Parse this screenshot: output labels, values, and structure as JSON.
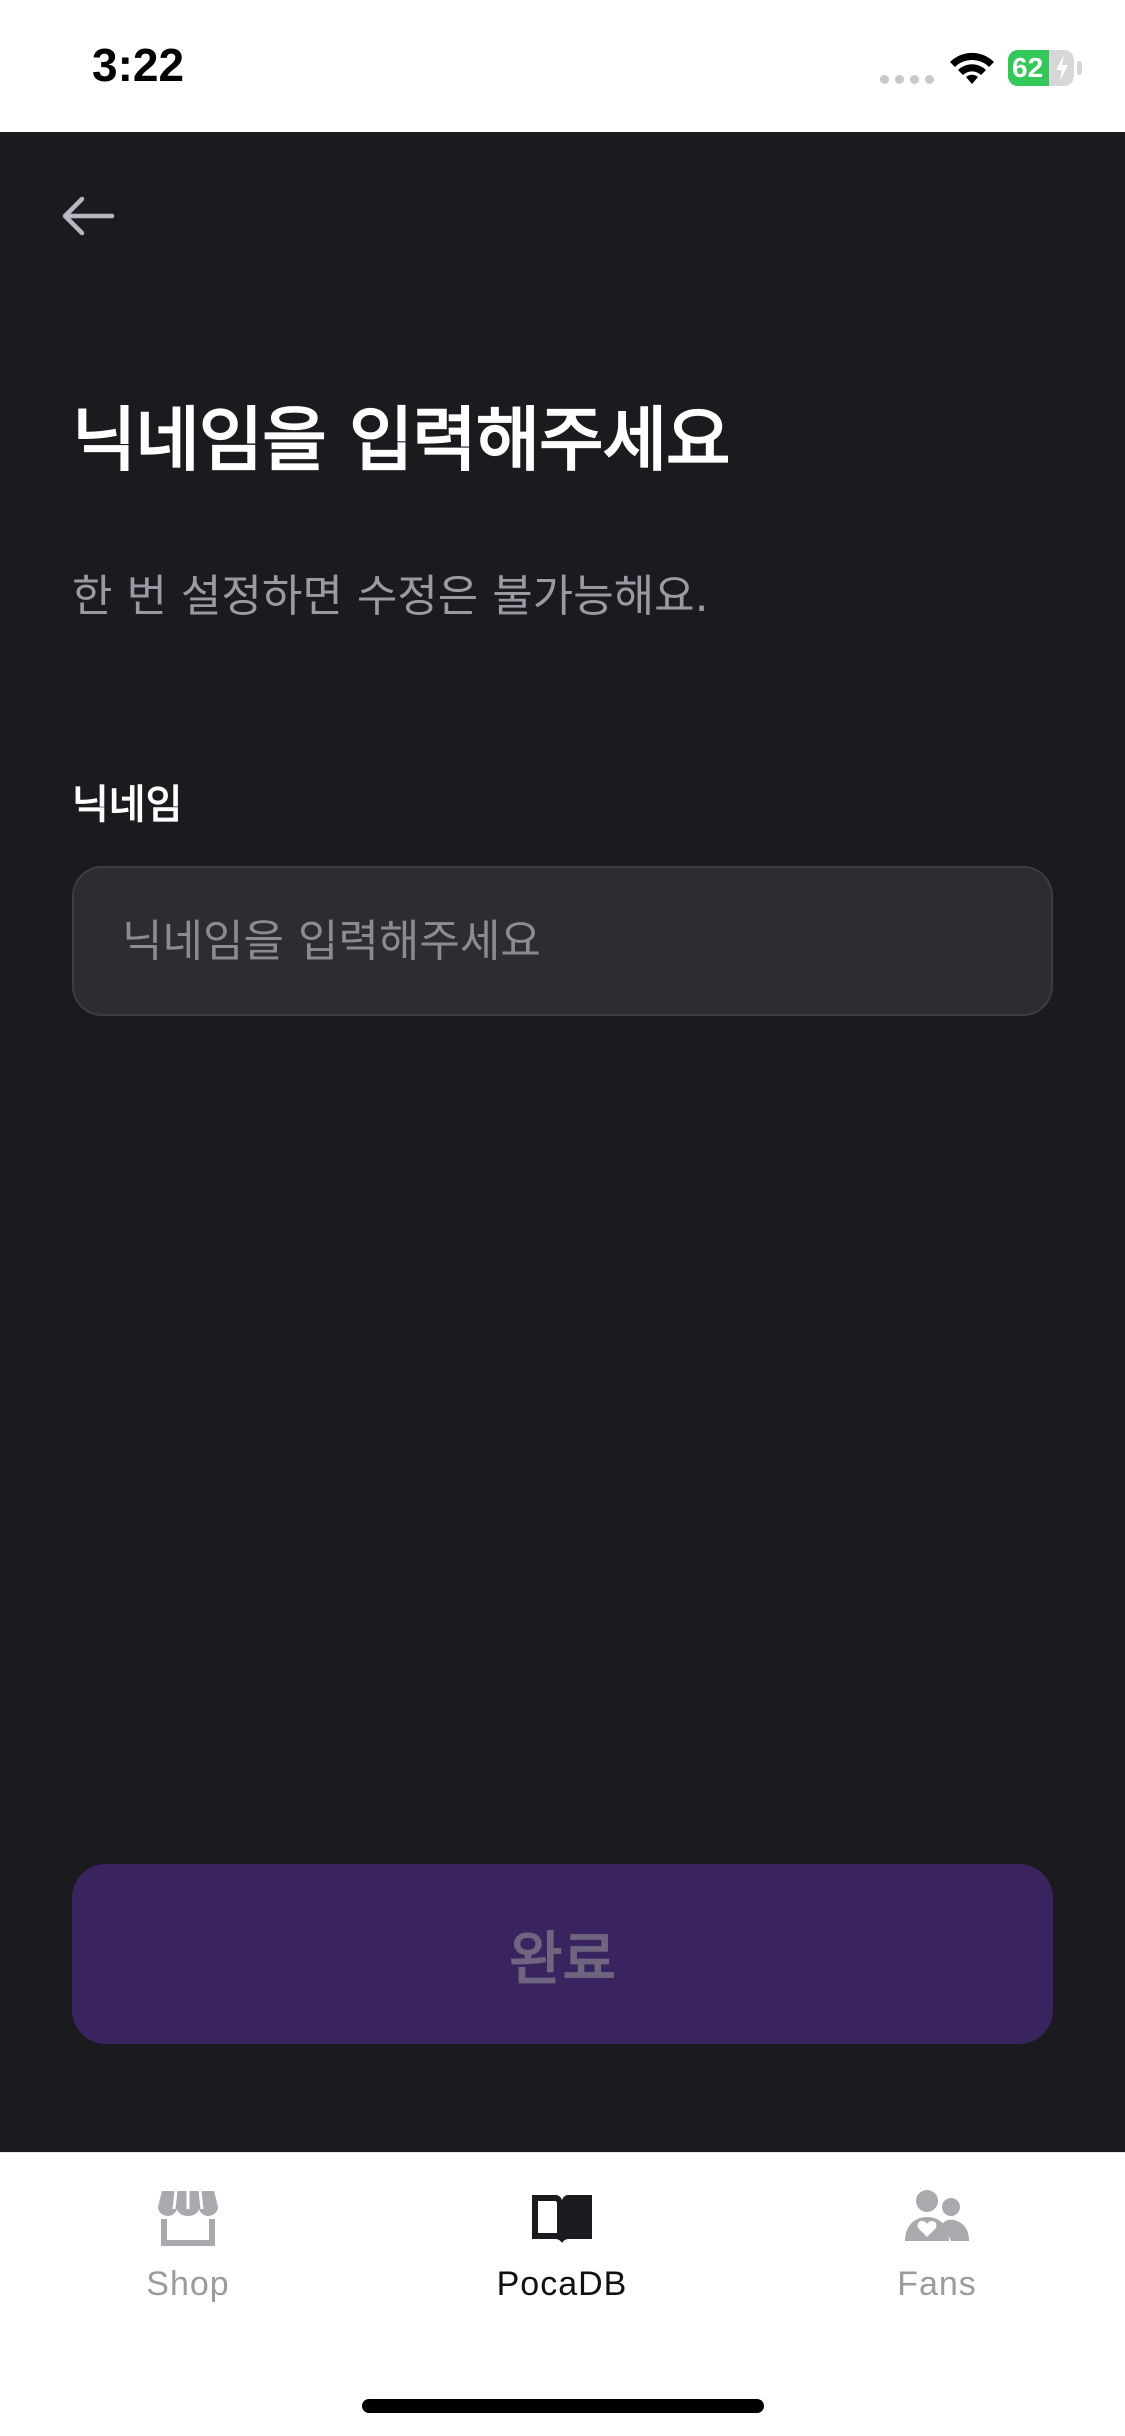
{
  "status_bar": {
    "time": "3:22",
    "battery_level": "62",
    "battery_fraction": 0.62
  },
  "header": {
    "back_icon": "arrow-left-icon"
  },
  "form": {
    "title": "닉네임을 입력해주세요",
    "subtitle": "한 번 설정하면 수정은 불가능해요.",
    "field_label": "닉네임",
    "input_placeholder": "닉네임을 입력해주세요",
    "input_value": "",
    "submit_label": "완료"
  },
  "tab_bar": {
    "tabs": [
      {
        "label": "Shop",
        "icon": "store-icon",
        "active": false
      },
      {
        "label": "PocaDB",
        "icon": "book-icon",
        "active": true
      },
      {
        "label": "Fans",
        "icon": "users-heart-icon",
        "active": false
      }
    ]
  },
  "colors": {
    "background": "#1b1a1f",
    "input_bg": "#2d2c31",
    "button_bg": "#3a2460",
    "button_text": "#6f657f",
    "battery_green": "#34c759"
  }
}
